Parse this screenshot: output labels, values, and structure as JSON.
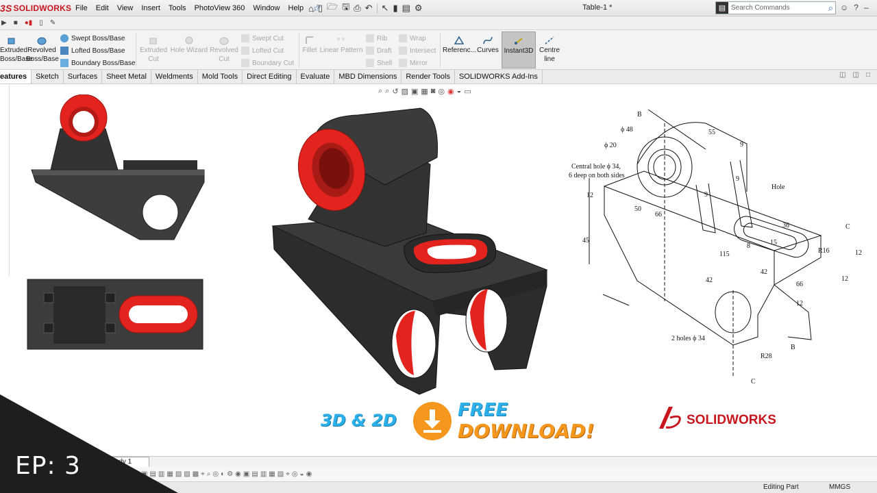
{
  "app": {
    "brand": "SOLIDWORKS",
    "document_title": "Table-1 *"
  },
  "menu": [
    "File",
    "Edit",
    "View",
    "Insert",
    "Tools",
    "PhotoView 360",
    "Window",
    "Help"
  ],
  "search": {
    "placeholder": "Search Commands"
  },
  "ribbon": {
    "extruded": "Extruded Boss/Base",
    "extruded_l1": "Extruded",
    "extruded_l2": "Boss/Base",
    "revolved_l1": "Revolved",
    "revolved_l2": "Boss/Base",
    "swept_boss": "Swept Boss/Base",
    "lofted_boss": "Lofted Boss/Base",
    "boundary_boss": "Boundary Boss/Base",
    "extruded_cut_l1": "Extruded",
    "extruded_cut_l2": "Cut",
    "hole_wizard": "Hole Wizard",
    "revolved_cut_l1": "Revolved",
    "revolved_cut_l2": "Cut",
    "swept_cut": "Swept Cut",
    "lofted_cut": "Lofted Cut",
    "boundary_cut": "Boundary Cut",
    "fillet": "Fillet",
    "linear_pattern": "Linear Pattern",
    "rib": "Rib",
    "draft": "Draft",
    "shell": "Shell",
    "wrap": "Wrap",
    "intersect": "Intersect",
    "mirror": "Mirror",
    "reference": "Referenc...",
    "curves": "Curves",
    "instant3d": "Instant3D",
    "centre_l1": "Centre",
    "centre_l2": "line"
  },
  "tabs": [
    "eatures",
    "Sketch",
    "Surfaces",
    "Sheet Metal",
    "Weldments",
    "Mold Tools",
    "Direct Editing",
    "Evaluate",
    "MBD Dimensions",
    "Render Tools",
    "SOLIDWORKS Add-Ins"
  ],
  "bottom": {
    "study_tab": "tudy 1"
  },
  "status": {
    "mode": "Editing Part",
    "units": "MMGS"
  },
  "overlay": {
    "episode": "EP: 3"
  },
  "banner": {
    "left": "3D & 2D",
    "free": "FREE",
    "download": "DOWNLOAD!",
    "brand_mark": "SOLIDWORKS"
  },
  "drawing": {
    "labels": {
      "b_top": "B",
      "phi48": "ϕ 48",
      "phi20": "ϕ 20",
      "central_hole_1": "Central hole ϕ 34,",
      "central_hole_2": "6 deep on both sides",
      "d55": "55",
      "d9a": "9",
      "d9b": "9",
      "d9c": "9",
      "hole": "Hole",
      "d12a": "12",
      "d50": "50",
      "d66a": "66",
      "d36": "36",
      "c_top": "C",
      "d45": "45",
      "d15": "15",
      "d8": "8",
      "r16": "R16",
      "d12b": "12",
      "d115": "115",
      "d42a": "42",
      "d42b": "42",
      "d66b": "66",
      "d12c": "12",
      "d12d": "12",
      "holes2": "2 holes ϕ 34",
      "r28": "R28",
      "b_bottom": "B",
      "c_bottom": "C"
    }
  },
  "colors": {
    "accent_red": "#e3231d",
    "solid_gray": "#3a3a3a",
    "blue_text": "#2bb0ea",
    "orange_text": "#f5961d",
    "brand_red": "#c7161e"
  }
}
